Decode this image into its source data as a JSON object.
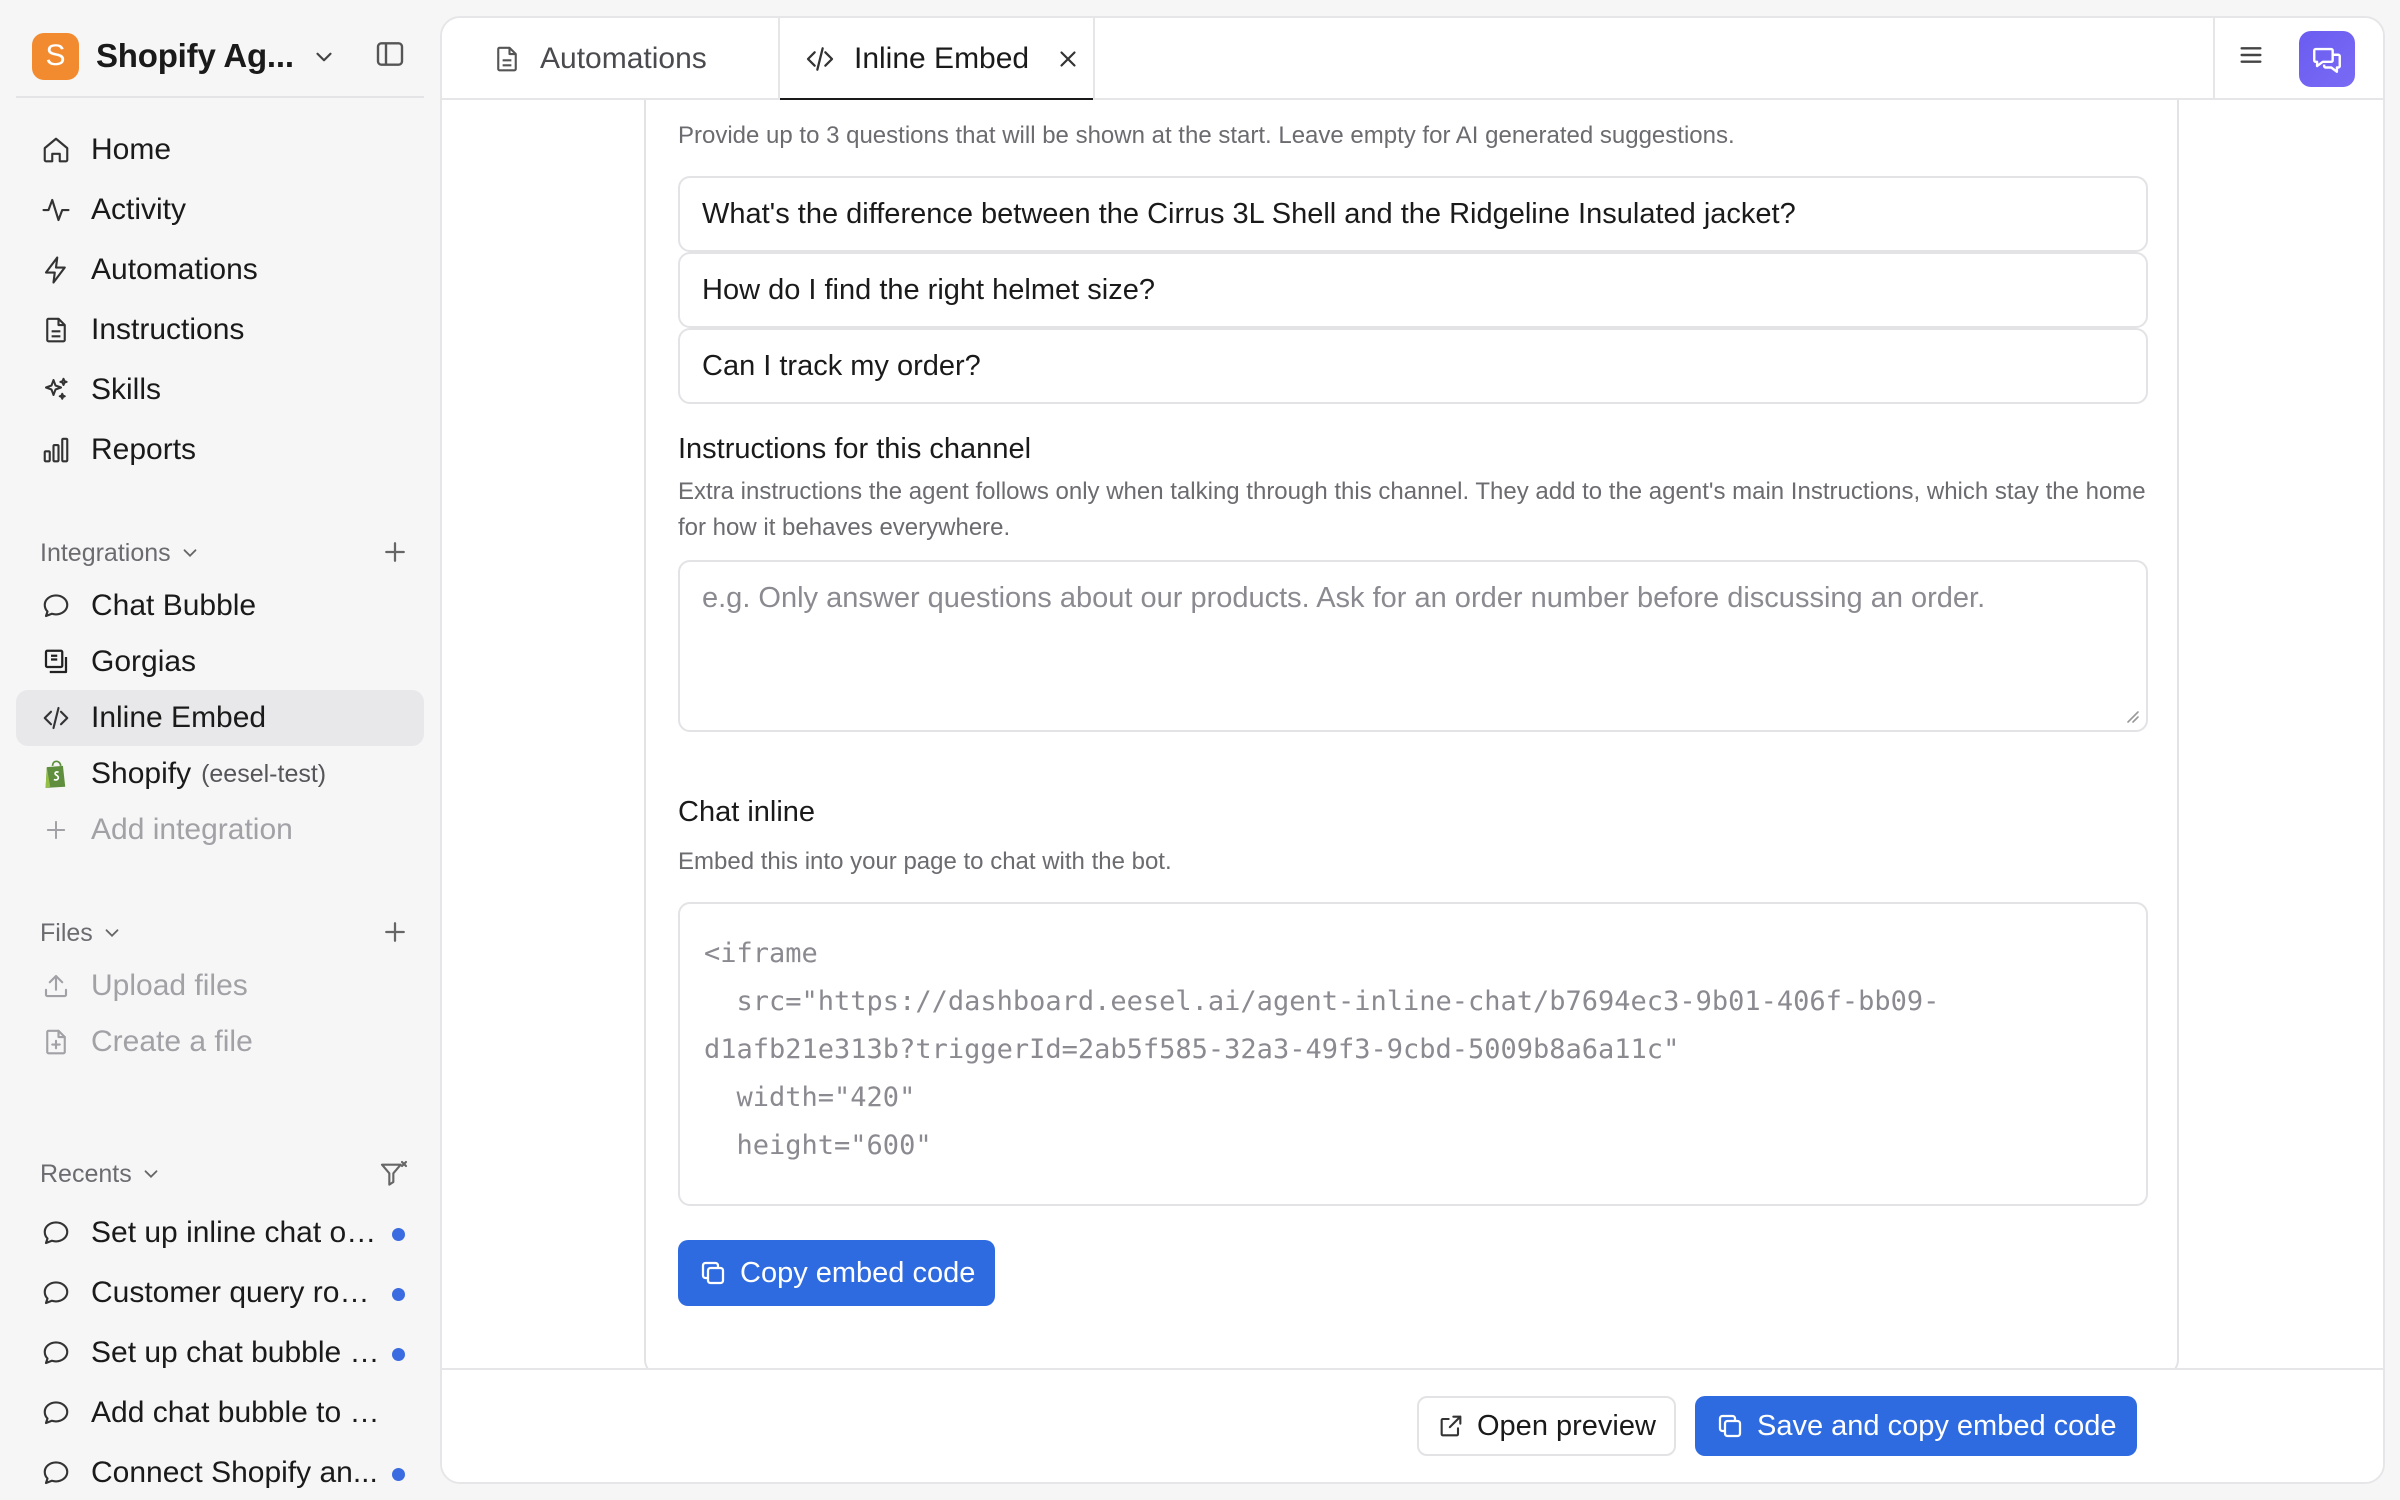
{
  "workspace": {
    "initial": "S",
    "name": "Shopify Ag..."
  },
  "nav": [
    {
      "label": "Home",
      "icon": "home-icon"
    },
    {
      "label": "Activity",
      "icon": "activity-icon"
    },
    {
      "label": "Automations",
      "icon": "lightning-icon"
    },
    {
      "label": "Instructions",
      "icon": "document-icon"
    },
    {
      "label": "Skills",
      "icon": "sparkles-icon"
    },
    {
      "label": "Reports",
      "icon": "bar-chart-icon"
    }
  ],
  "integrations": {
    "heading": "Integrations",
    "items": [
      {
        "label": "Chat Bubble",
        "icon": "chat-bubble-icon"
      },
      {
        "label": "Gorgias",
        "icon": "gorgias-icon"
      },
      {
        "label": "Inline Embed",
        "icon": "code-icon"
      },
      {
        "label": "Shopify",
        "sub": "(eesel-test)",
        "icon": "shopify-icon"
      },
      {
        "label": "Add integration",
        "icon": "plus-icon"
      }
    ]
  },
  "files": {
    "heading": "Files",
    "items": [
      {
        "label": "Upload files",
        "icon": "upload-icon"
      },
      {
        "label": "Create a file",
        "icon": "new-file-icon"
      }
    ]
  },
  "recents": {
    "heading": "Recents",
    "items": [
      {
        "label": "Set up inline chat on ..."
      },
      {
        "label": "Customer query rout..."
      },
      {
        "label": "Set up chat bubble h..."
      },
      {
        "label": "Add chat bubble to Sh..."
      },
      {
        "label": "Connect Shopify an..."
      }
    ]
  },
  "tabs": {
    "automations": "Automations",
    "inline_embed": "Inline Embed"
  },
  "suggested": {
    "description": "Provide up to 3 questions that will be shown at the start. Leave empty for AI generated suggestions.",
    "questions": [
      "What's the difference between the Cirrus 3L Shell and the Ridgeline Insulated jacket?",
      "How do I find the right helmet size?",
      "Can I track my order?"
    ]
  },
  "channel_instructions": {
    "title": "Instructions for this channel",
    "description": "Extra instructions the agent follows only when talking through this channel. They add to the agent's main Instructions, which stay the home for how it behaves everywhere.",
    "placeholder": "e.g. Only answer questions about our products. Ask for an order number before discussing an order."
  },
  "chat_inline": {
    "title": "Chat inline",
    "description": "Embed this into your page to chat with the bot.",
    "code": "<iframe\n  src=\"https://dashboard.eesel.ai/agent-inline-chat/b7694ec3-9b01-406f-bb09-\nd1afb21e313b?triggerId=2ab5f585-32a3-49f3-9cbd-5009b8a6a11c\"\n  width=\"420\"\n  height=\"600\"",
    "copy_button": "Copy embed code"
  },
  "footer": {
    "preview_button": "Open preview",
    "save_button": "Save and copy embed code"
  }
}
